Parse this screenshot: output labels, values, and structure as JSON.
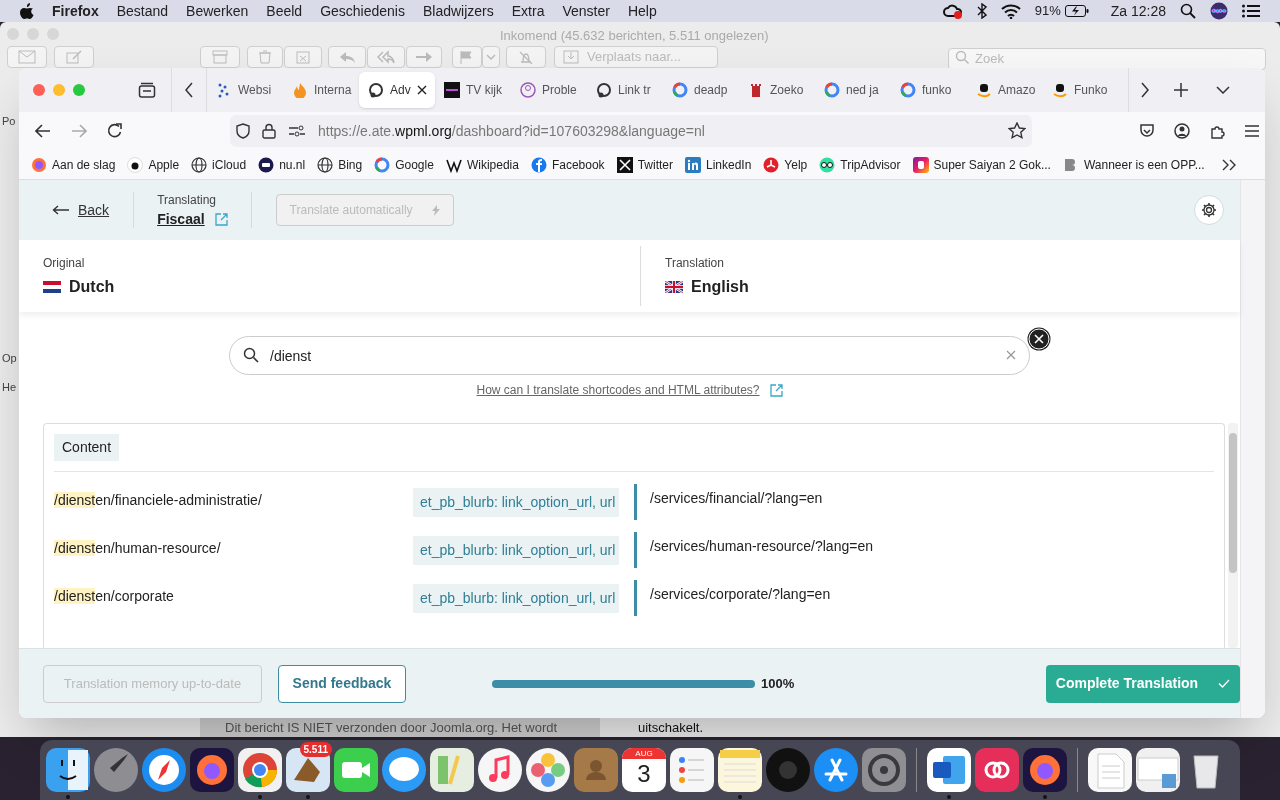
{
  "menu_bar": {
    "app": "Firefox",
    "menus": [
      "Bestand",
      "Bewerken",
      "Beeld",
      "Geschiedenis",
      "Bladwijzers",
      "Extra",
      "Venster",
      "Help"
    ],
    "battery": "91%",
    "clock": "Za 12:28"
  },
  "mail_window": {
    "title": "Inkomend (45.632 berichten, 5.511 ongelezen)",
    "move_button": "Verplaats naar...",
    "search_placeholder": "Zoek",
    "sidebar_fragments": [
      "Po",
      "Op",
      "He"
    ],
    "message_line": "Dit bericht IS NIET verzonden door Joomla.org. Het wordt",
    "message_end": "uitschakelt."
  },
  "browser": {
    "tabs": [
      {
        "label": "Websi",
        "kind": "dots",
        "selected": false
      },
      {
        "label": "Interna",
        "kind": "flame",
        "selected": false
      },
      {
        "label": "Adv",
        "kind": "ring",
        "selected": true
      },
      {
        "label": "TV kijk",
        "kind": "tv",
        "selected": false
      },
      {
        "label": "Proble",
        "kind": "head",
        "selected": false
      },
      {
        "label": "Link tr",
        "kind": "ring",
        "selected": false
      },
      {
        "label": "deadp",
        "kind": "google",
        "selected": false
      },
      {
        "label": "Zoeko",
        "kind": "tower",
        "selected": false
      },
      {
        "label": "ned ja",
        "kind": "google",
        "selected": false
      },
      {
        "label": "funko",
        "kind": "google",
        "selected": false
      },
      {
        "label": "Amazo",
        "kind": "amazon",
        "selected": false
      },
      {
        "label": "Funko",
        "kind": "amazon",
        "selected": false
      }
    ],
    "url": {
      "start": "https://e.ate.",
      "domain": "wpml.org",
      "path": "/dashboard?id=107603298&language=nl"
    },
    "bookmarks": [
      {
        "label": "Aan de slag",
        "kind": "firefox"
      },
      {
        "label": "Apple",
        "kind": "apple"
      },
      {
        "label": "iCloud",
        "kind": "globe"
      },
      {
        "label": "nu.nl",
        "kind": "nu"
      },
      {
        "label": "Bing",
        "kind": "globe"
      },
      {
        "label": "Google",
        "kind": "google"
      },
      {
        "label": "Wikipedia",
        "kind": "wiki"
      },
      {
        "label": "Facebook",
        "kind": "facebook"
      },
      {
        "label": "Twitter",
        "kind": "x"
      },
      {
        "label": "LinkedIn",
        "kind": "linkedin"
      },
      {
        "label": "Yelp",
        "kind": "yelp"
      },
      {
        "label": "TripAdvisor",
        "kind": "owl"
      },
      {
        "label": "Super Saiyan 2 Gok...",
        "kind": "gradient"
      },
      {
        "label": "Wanneer is een OPP...",
        "kind": "grey"
      }
    ]
  },
  "editor": {
    "back": "Back",
    "translating_label": "Translating",
    "document": "Fiscaal",
    "auto_translate": {
      "label": "Translate automatically",
      "disabled": true
    },
    "original": {
      "label": "Original",
      "language": "Dutch",
      "kind": "nl"
    },
    "translation": {
      "label": "Translation",
      "language": "English",
      "kind": "gb"
    },
    "search": {
      "value": "/dienst"
    },
    "help_link": "How can I translate shortcodes and HTML attributes?",
    "section": "Content",
    "rows": [
      {
        "match": "/dienst",
        "rest": "en/financiele-administratie/",
        "tag": "et_pb_blurb: link_option_url, url",
        "translation": "/services/financial/?lang=en"
      },
      {
        "match": "/dienst",
        "rest": "en/human-resource/",
        "tag": "et_pb_blurb: link_option_url, url",
        "translation": "/services/human-resource/?lang=en"
      },
      {
        "match": "/dienst",
        "rest": "en/corporate",
        "tag": "et_pb_blurb: link_option_url, url",
        "translation": "/services/corporate/?lang=en"
      }
    ],
    "footer": {
      "memory_button": {
        "label": "Translation memory up-to-date",
        "disabled": true
      },
      "feedback": "Send feedback",
      "progress": {
        "level": 1,
        "reading": "100%"
      },
      "complete": "Complete Translation"
    }
  },
  "dock": [
    {
      "kind": "finder",
      "running": true
    },
    {
      "kind": "launchpad",
      "running": false
    },
    {
      "kind": "safari",
      "running": false
    },
    {
      "kind": "firefox",
      "running": false
    },
    {
      "kind": "chrome",
      "running": true
    },
    {
      "kind": "mail",
      "running": true,
      "badge": "5.511"
    },
    {
      "kind": "facetime",
      "running": false
    },
    {
      "kind": "messages",
      "running": false
    },
    {
      "kind": "maps",
      "running": false
    },
    {
      "kind": "music",
      "running": false
    },
    {
      "kind": "photos",
      "running": false
    },
    {
      "kind": "contacts",
      "running": false
    },
    {
      "kind": "calendar",
      "running": false,
      "month": "AUG",
      "day": "3"
    },
    {
      "kind": "reminders",
      "running": false
    },
    {
      "kind": "notes",
      "running": true
    },
    {
      "kind": "tv",
      "running": false
    },
    {
      "kind": "appstore",
      "running": false
    },
    {
      "kind": "settings",
      "running": false
    },
    {
      "kind": "separator"
    },
    {
      "kind": "word",
      "running": true
    },
    {
      "kind": "creative",
      "running": false
    },
    {
      "kind": "firefox",
      "running": true
    },
    {
      "kind": "separator"
    },
    {
      "kind": "document",
      "running": false
    },
    {
      "kind": "preview",
      "running": false
    },
    {
      "kind": "trash",
      "running": false
    }
  ]
}
